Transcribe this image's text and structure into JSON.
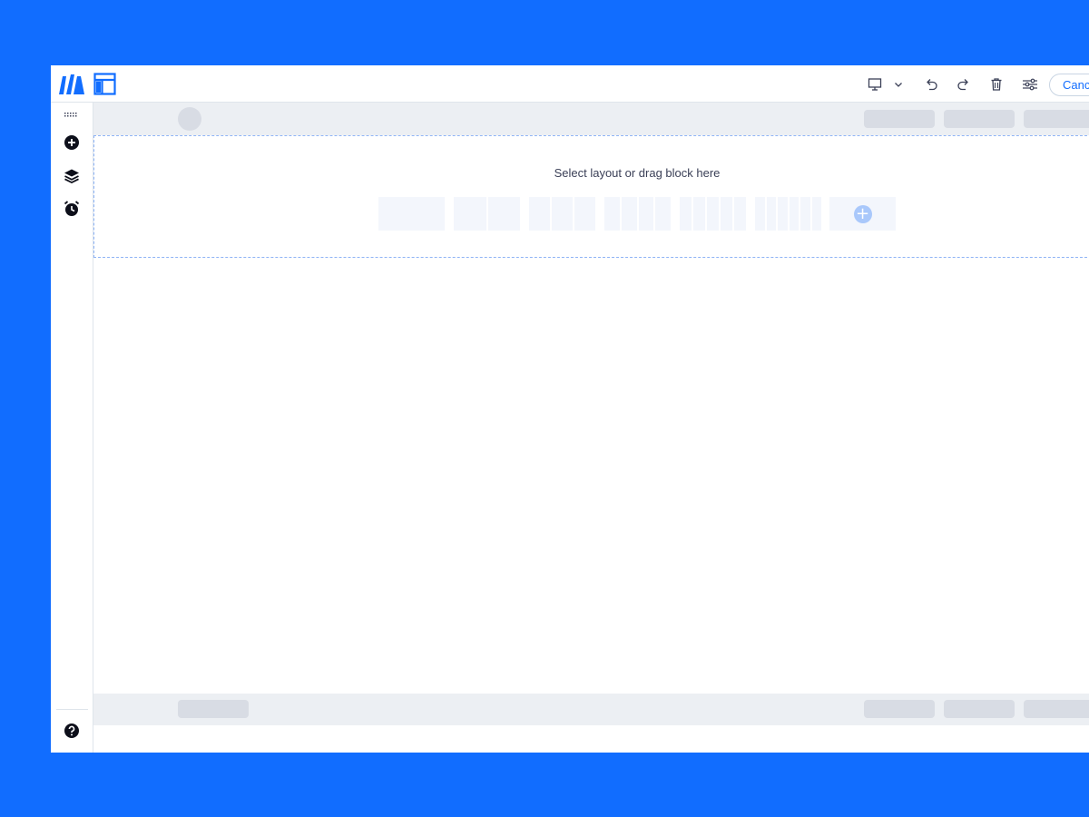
{
  "toolbar": {
    "cancel_label": "Canc"
  },
  "canvas": {
    "dropzone_text": "Select layout or drag block here",
    "add_layout_glyph": "+"
  },
  "colors": {
    "brand": "#116dff",
    "placeholder": "#d8dce4",
    "strip": "#eceff3",
    "dropzone_border": "#8fb4f5"
  },
  "icons": {
    "logo": "brand-logo-icon",
    "layout": "layout-icon",
    "device": "desktop-icon",
    "chevron": "chevron-down-icon",
    "undo": "undo-icon",
    "redo": "redo-icon",
    "delete": "trash-icon",
    "settings": "sliders-icon",
    "add": "add-circle-icon",
    "layers": "layers-icon",
    "history": "alarm-clock-icon",
    "help": "help-icon"
  }
}
